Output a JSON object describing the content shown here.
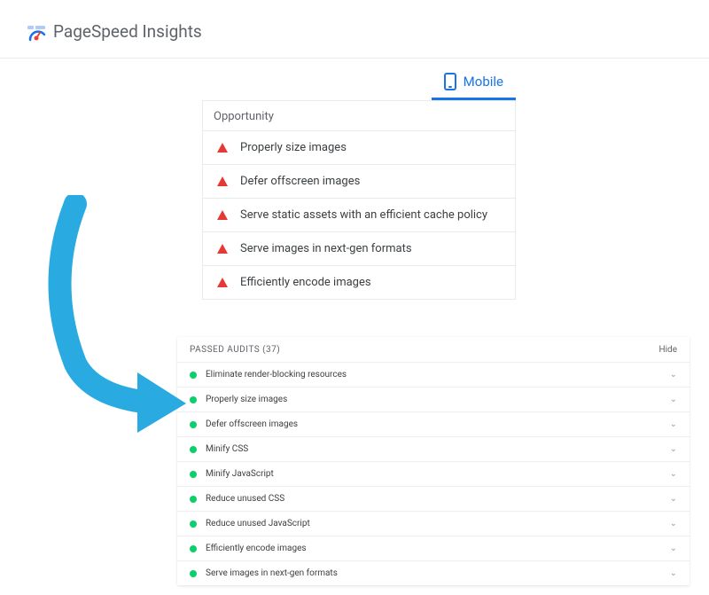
{
  "header": {
    "title": "PageSpeed Insights"
  },
  "tabs": {
    "mobile": "Mobile"
  },
  "opportunity": {
    "section_label": "Opportunity",
    "items": [
      "Properly size images",
      "Defer offscreen images",
      "Serve static assets with an efficient cache policy",
      "Serve images in next-gen formats",
      "Efficiently encode images"
    ]
  },
  "passed": {
    "title": "PASSED AUDITS (37)",
    "hide_label": "Hide",
    "items": [
      "Eliminate render-blocking resources",
      "Properly size images",
      "Defer offscreen images",
      "Minify CSS",
      "Minify JavaScript",
      "Reduce unused CSS",
      "Reduce unused JavaScript",
      "Efficiently encode images",
      "Serve images in next-gen formats"
    ]
  }
}
